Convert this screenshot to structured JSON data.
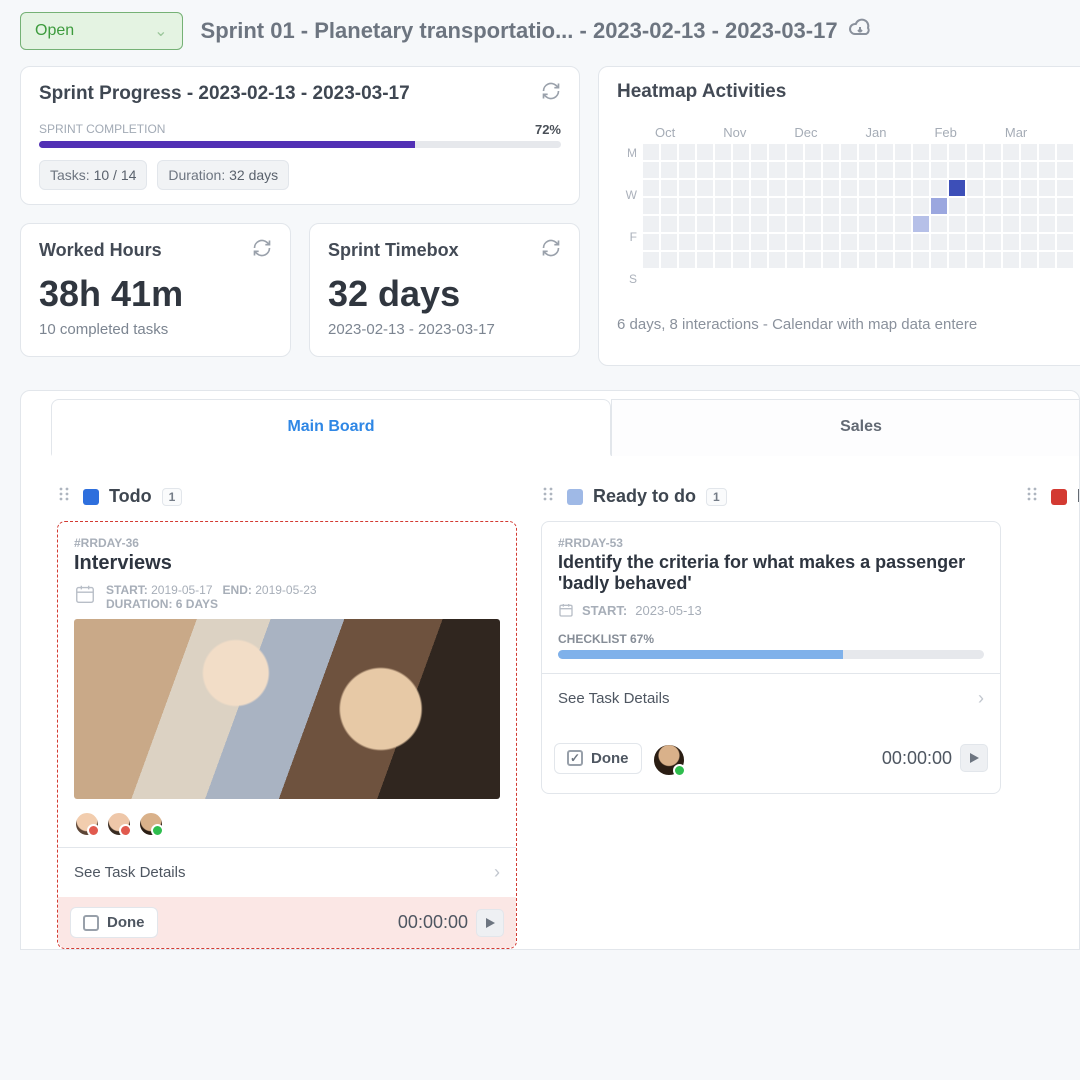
{
  "header": {
    "status_label": "Open",
    "title": "Sprint 01 - Planetary transportatio... - 2023-02-13 - 2023-03-17"
  },
  "sprint_progress": {
    "title": "Sprint Progress - 2023-02-13 - 2023-03-17",
    "label": "SPRINT COMPLETION",
    "percent_text": "72%",
    "percent": 72,
    "tasks_chip_label": "Tasks:",
    "tasks_chip_value": "10 / 14",
    "duration_chip_label": "Duration:",
    "duration_chip_value": "32 days"
  },
  "worked_hours": {
    "title": "Worked Hours",
    "value": "38h 41m",
    "sub": "10 completed tasks"
  },
  "timebox": {
    "title": "Sprint Timebox",
    "value": "32 days",
    "sub": "2023-02-13 - 2023-03-17"
  },
  "heatmap": {
    "title": "Heatmap Activities",
    "months": [
      "Oct",
      "Nov",
      "Dec",
      "Jan",
      "Feb",
      "Mar"
    ],
    "days": [
      "M",
      "",
      "W",
      "",
      "F",
      "",
      "S"
    ],
    "note": "6 days, 8 interactions - Calendar with map data entere"
  },
  "board": {
    "tabs": {
      "main": "Main Board",
      "sales": "Sales"
    },
    "columns": {
      "todo": {
        "name": "Todo",
        "count": "1"
      },
      "ready": {
        "name": "Ready to do",
        "count": "1"
      },
      "inprog": {
        "name": "In "
      }
    },
    "task1": {
      "id": "#RRDAY-36",
      "title": "Interviews",
      "start_label": "START:",
      "start": "2019-05-17",
      "end_label": "END:",
      "end": "2019-05-23",
      "duration_label": "DURATION: 6 DAYS",
      "details": "See Task Details",
      "done": "Done",
      "timer": "00:00:00"
    },
    "task2": {
      "id": "#RRDAY-53",
      "title": "Identify the criteria for what makes a passenger 'badly behaved'",
      "start_label": "START:",
      "start": "2023-05-13",
      "checklist_label": "CHECKLIST 67%",
      "checklist_pct": 67,
      "details": "See Task Details",
      "done": "Done",
      "timer": "00:00:00"
    }
  }
}
